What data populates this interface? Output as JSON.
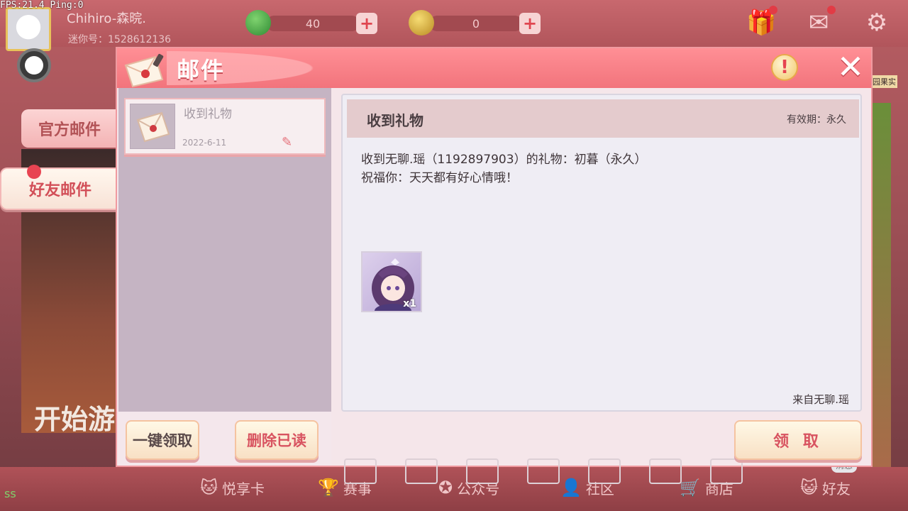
{
  "overlay": {
    "fps_text": "FPS:21.4  Ping:0"
  },
  "player": {
    "name": "Chihiro-森晥.",
    "id_text": "迷你号：1528612136"
  },
  "currencies": [
    {
      "name": "green-gem",
      "amount": "40",
      "color": "#2f9a3a"
    },
    {
      "name": "gold-coin",
      "amount": "0",
      "color": "#d8b03a"
    }
  ],
  "top_icons": [
    "gift-icon",
    "mail-icon",
    "settings-icon"
  ],
  "background": {
    "poster_text": "开始游",
    "side_label": "园果实"
  },
  "mail_tabs": [
    {
      "label": "官方邮件",
      "active": false
    },
    {
      "label": "好友邮件",
      "active": true
    }
  ],
  "dialog": {
    "title": "邮件",
    "info_symbol": "!",
    "close_symbol": "✕",
    "mails": [
      {
        "subject": "收到礼物",
        "date": "2022-6-11"
      }
    ],
    "buttons": {
      "claim_all": "一键领取",
      "delete_read": "删除已读",
      "claim": "领 取"
    },
    "detail": {
      "subject": "收到礼物",
      "validity": "有效期：永久",
      "body_line_1": "收到无聊.瑶（1192897903）的礼物：初暮（永久）",
      "body_line_2": "祝福你：天天都有好心情哦！",
      "reward_qty": "x1",
      "sender": "来自无聊.瑶"
    }
  },
  "bottom_nav": [
    {
      "label": "悦享卡",
      "icon": "cat-card-icon"
    },
    {
      "label": "赛事",
      "icon": "trophy-icon"
    },
    {
      "label": "公众号",
      "icon": "star-badge-icon"
    },
    {
      "label": "社区",
      "icon": "community-icon"
    },
    {
      "label": "商店",
      "icon": "cart-icon"
    },
    {
      "label": "好友",
      "icon": "friend-cat-icon"
    }
  ],
  "message_tag": "消息",
  "colors": {
    "accent": "#f2747c",
    "dialog_bg": "#f5e6ea",
    "red_text": "#d85360"
  }
}
